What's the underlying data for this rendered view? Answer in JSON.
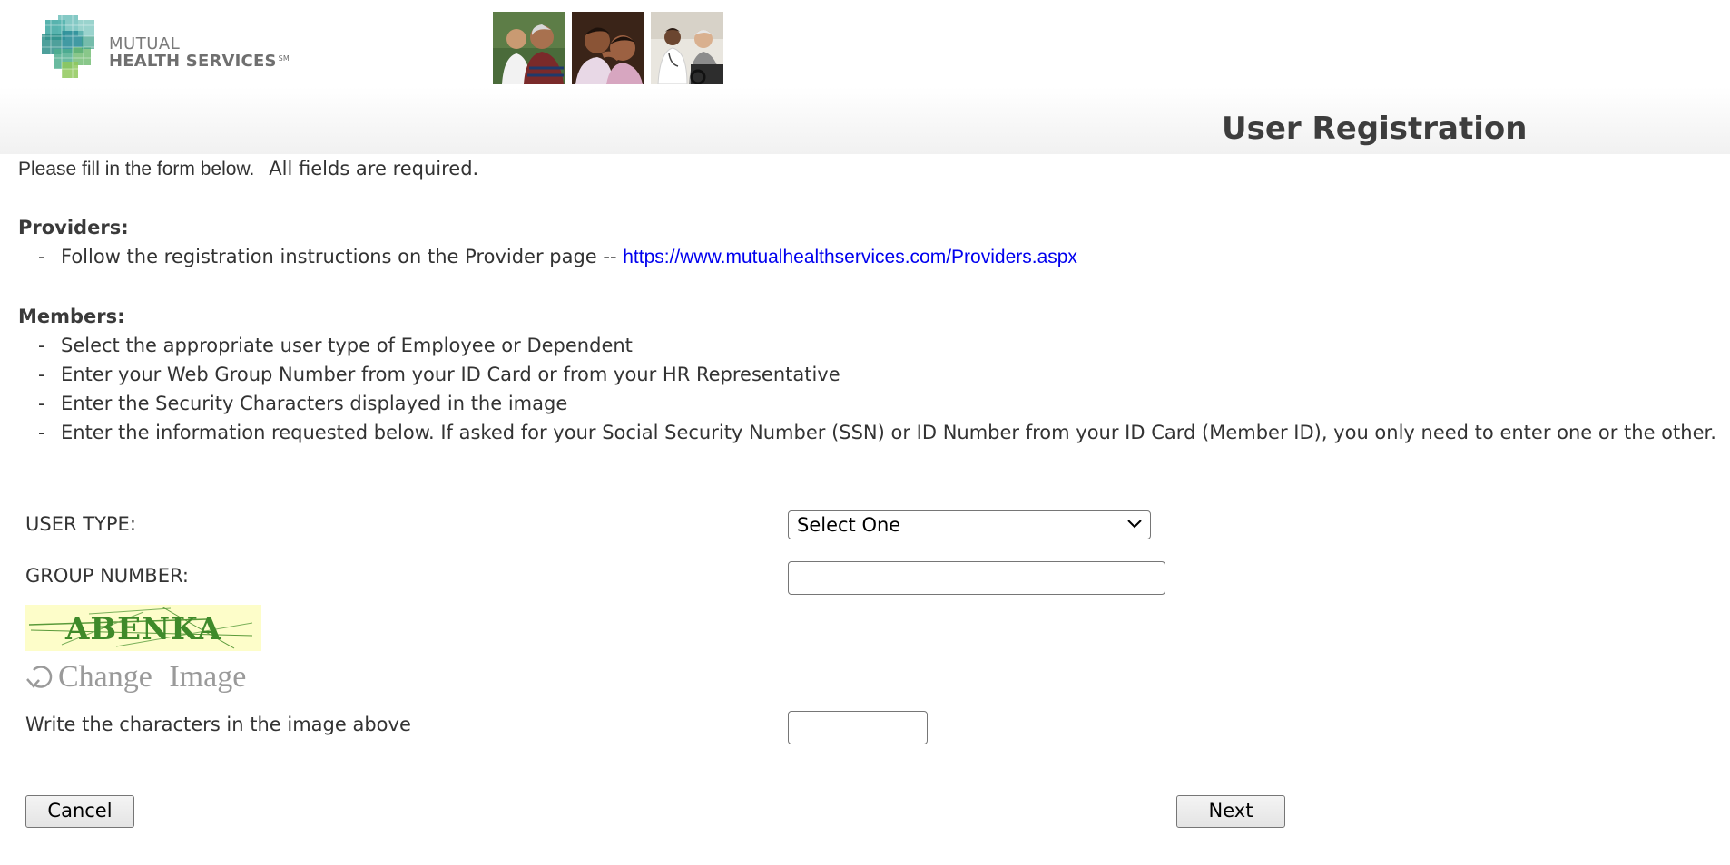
{
  "brand": {
    "line1": "MUTUAL",
    "line2": "HEALTH SERVICES",
    "trademark": "SM"
  },
  "header": {
    "title": "User Registration",
    "photos": [
      "family-photo",
      "children-photo",
      "doctor-photo"
    ]
  },
  "intro": {
    "part1": "Please fill in the form below.",
    "part2": "All fields are required."
  },
  "providers": {
    "heading": "Providers:",
    "bullet_prefix": "-",
    "instruction": "Follow the registration instructions on the Provider page -- ",
    "link_text": "https://www.mutualhealthservices.com/Providers.aspx"
  },
  "members": {
    "heading": "Members:",
    "bullet_prefix": "-",
    "items": [
      "Select the appropriate user type of Employee or Dependent",
      "Enter your Web Group Number from your ID Card or from your HR Representative",
      "Enter the Security Characters displayed in the image",
      "Enter the information requested below.  If asked for your Social Security Number (SSN) or ID Number from your ID Card (Member ID), you only need to enter one or the other."
    ]
  },
  "form": {
    "user_type_label": "USER TYPE:",
    "user_type_value": "Select One",
    "group_number_label": "GROUP NUMBER:",
    "group_number_value": "",
    "captcha_text": "ABENKA",
    "change_image_label": "Change Image",
    "captcha_prompt": "Write the characters in the image above",
    "captcha_value": ""
  },
  "actions": {
    "cancel": "Cancel",
    "next": "Next"
  },
  "colors": {
    "link": "#0000ee",
    "captcha_bg": "#fdfdc9",
    "captcha_text": "#3f8a2a",
    "logo_teal": "#2f9f9a"
  }
}
